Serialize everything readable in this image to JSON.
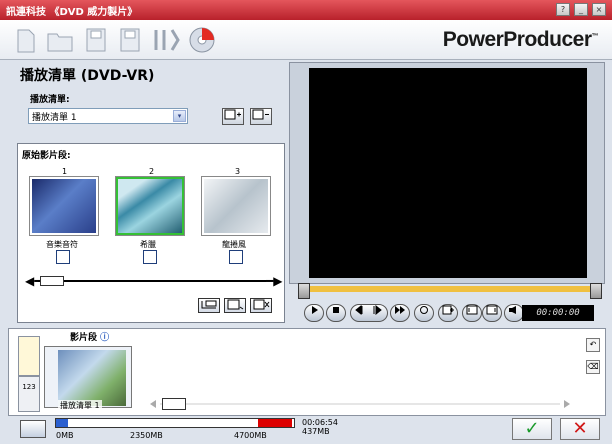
{
  "titlebar": {
    "title": "訊連科技 《DVD 威力製片》",
    "help": "?",
    "minimize": "_",
    "close": "×"
  },
  "toolbar": {
    "brand": "PowerProducer",
    "brand_mark": "™"
  },
  "main": {
    "title": "播放清單 (DVD-VR)",
    "playlist_label": "播放清單:",
    "playlist_value": "播放清單 1",
    "select_arrow": "▾"
  },
  "clips": {
    "label": "原始影片段:",
    "items": [
      {
        "num": "1",
        "name": "音樂音符"
      },
      {
        "num": "2",
        "name": "希臘"
      },
      {
        "num": "3",
        "name": "龍捲風"
      }
    ],
    "seek_left": "◀━",
    "seek_right": "━▶"
  },
  "player": {
    "timecode": "00:00:00"
  },
  "bottom": {
    "label": "影片段",
    "info_icon": "ⓘ",
    "chapter_label": "播放清單 1",
    "tab2_label": "123"
  },
  "status": {
    "size_0": "0MB",
    "size_1": "2350MB",
    "size_2": "4700MB",
    "time_used": "00:06:54",
    "space_used": "437MB"
  },
  "colors": {
    "titlebar": "#c0232d",
    "accent_yellow": "#f0c040",
    "clip_selected": "#35c035",
    "ok": "#1a9a2a",
    "cancel": "#d01818"
  }
}
